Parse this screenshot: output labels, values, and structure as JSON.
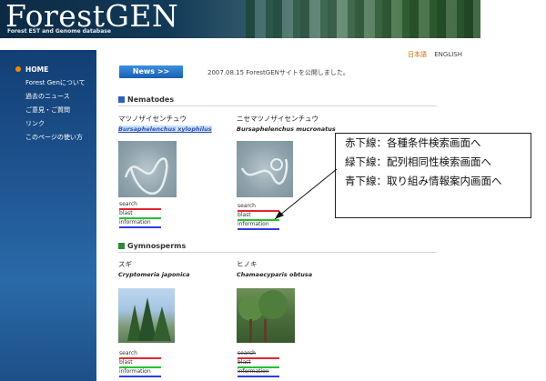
{
  "header": {
    "logo": "ForestGEN",
    "tagline": "Forest EST and Genome database"
  },
  "language": {
    "japanese": "日本語",
    "english": "ENGLISH"
  },
  "sidebar": {
    "items": [
      {
        "label": "HOME"
      },
      {
        "label": "Forest Genについて"
      },
      {
        "label": "過去のニュース"
      },
      {
        "label": "ご意見・ご質問"
      },
      {
        "label": "リンク"
      },
      {
        "label": "このページの使い方"
      }
    ]
  },
  "news": {
    "button": "News >>",
    "text": "2007.08.15  ForestGENサイトを公開しました。"
  },
  "sections": [
    {
      "title": "Nematodes",
      "color": "#2f5fb8",
      "items": [
        {
          "jp": "マツノザイセンチュウ",
          "sci": "Bursaphelenchus xylophilus",
          "links": [
            "search",
            "blast",
            "information"
          ]
        },
        {
          "jp": "ニセマツノザイセンチュウ",
          "sci": "Bursaphelenchus mucronatus",
          "links": [
            "search",
            "blast",
            "information"
          ]
        }
      ]
    },
    {
      "title": "Gymnosperms",
      "color": "#2e8a3a",
      "items": [
        {
          "jp": "スギ",
          "sci": "Cryptomeria japonica",
          "links": [
            "search",
            "blast",
            "information"
          ]
        },
        {
          "jp": "ヒノキ",
          "sci": "Chamaecyparis obtusa",
          "links": [
            "search",
            "blast",
            "information"
          ]
        }
      ]
    }
  ],
  "callout": [
    "赤下線：各種条件検索画面へ",
    "緑下線：配列相同性検索画面へ",
    "青下線：取り組み情報案内画面へ"
  ]
}
